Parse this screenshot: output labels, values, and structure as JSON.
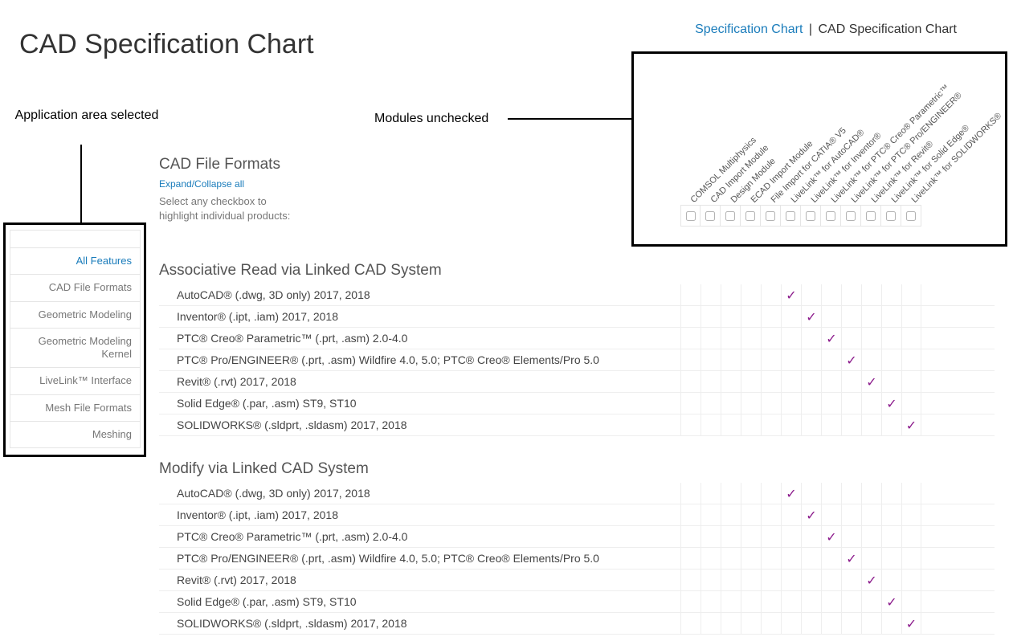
{
  "page_title": "CAD Specification Chart",
  "breadcrumb": {
    "link": "Specification Chart",
    "sep": "|",
    "current": "CAD Specification Chart"
  },
  "annotations": {
    "app_area": "Application area selected",
    "modules_unchecked": "Modules unchecked"
  },
  "sidebar": {
    "items": [
      {
        "label": "All Features",
        "active": true
      },
      {
        "label": "CAD File Formats",
        "active": false
      },
      {
        "label": "Geometric Modeling",
        "active": false
      },
      {
        "label": "Geometric Modeling Kernel",
        "active": false
      },
      {
        "label": "LiveLink™ Interface",
        "active": false
      },
      {
        "label": "Mesh File Formats",
        "active": false
      },
      {
        "label": "Meshing",
        "active": false
      }
    ]
  },
  "header_section": {
    "title": "CAD File Formats",
    "expand_link": "Expand/Collapse all",
    "hint_line1": "Select any checkbox to",
    "hint_line2": "highlight individual products:"
  },
  "modules": [
    "COMSOL Multiphysics",
    "CAD Import Module",
    "Design Module",
    "ECAD Import Module",
    "File Import for CATIA® V5",
    "LiveLink™ for AutoCAD®",
    "LiveLink™ for Inventor®",
    "LiveLink™ for PTC® Creo® Parametric™",
    "LiveLink™ for PTC® Pro/ENGINEER®",
    "LiveLink™ for Revit®",
    "LiveLink™ for Solid Edge®",
    "LiveLink™ for SOLIDWORKS®"
  ],
  "groups": [
    {
      "title": "Associative Read via Linked CAD System",
      "rows": [
        {
          "label": "AutoCAD® (.dwg, 3D only) 2017, 2018",
          "check": 5
        },
        {
          "label": "Inventor® (.ipt, .iam) 2017, 2018",
          "check": 6
        },
        {
          "label": "PTC® Creo® Parametric™ (.prt, .asm) 2.0-4.0",
          "check": 7
        },
        {
          "label": "PTC® Pro/ENGINEER® (.prt, .asm) Wildfire 4.0, 5.0; PTC® Creo® Elements/Pro 5.0",
          "check": 8
        },
        {
          "label": "Revit® (.rvt) 2017, 2018",
          "check": 9
        },
        {
          "label": "Solid Edge® (.par, .asm) ST9, ST10",
          "check": 10
        },
        {
          "label": "SOLIDWORKS® (.sldprt, .sldasm) 2017, 2018",
          "check": 11
        }
      ]
    },
    {
      "title": "Modify via Linked CAD System",
      "rows": [
        {
          "label": "AutoCAD® (.dwg, 3D only) 2017, 2018",
          "check": 5
        },
        {
          "label": "Inventor® (.ipt, .iam) 2017, 2018",
          "check": 6
        },
        {
          "label": "PTC® Creo® Parametric™ (.prt, .asm) 2.0-4.0",
          "check": 7
        },
        {
          "label": "PTC® Pro/ENGINEER® (.prt, .asm) Wildfire 4.0, 5.0; PTC® Creo® Elements/Pro 5.0",
          "check": 8
        },
        {
          "label": "Revit® (.rvt) 2017, 2018",
          "check": 9
        },
        {
          "label": "Solid Edge® (.par, .asm) ST9, ST10",
          "check": 10
        },
        {
          "label": "SOLIDWORKS® (.sldprt, .sldasm) 2017, 2018",
          "check": 11
        }
      ]
    }
  ]
}
